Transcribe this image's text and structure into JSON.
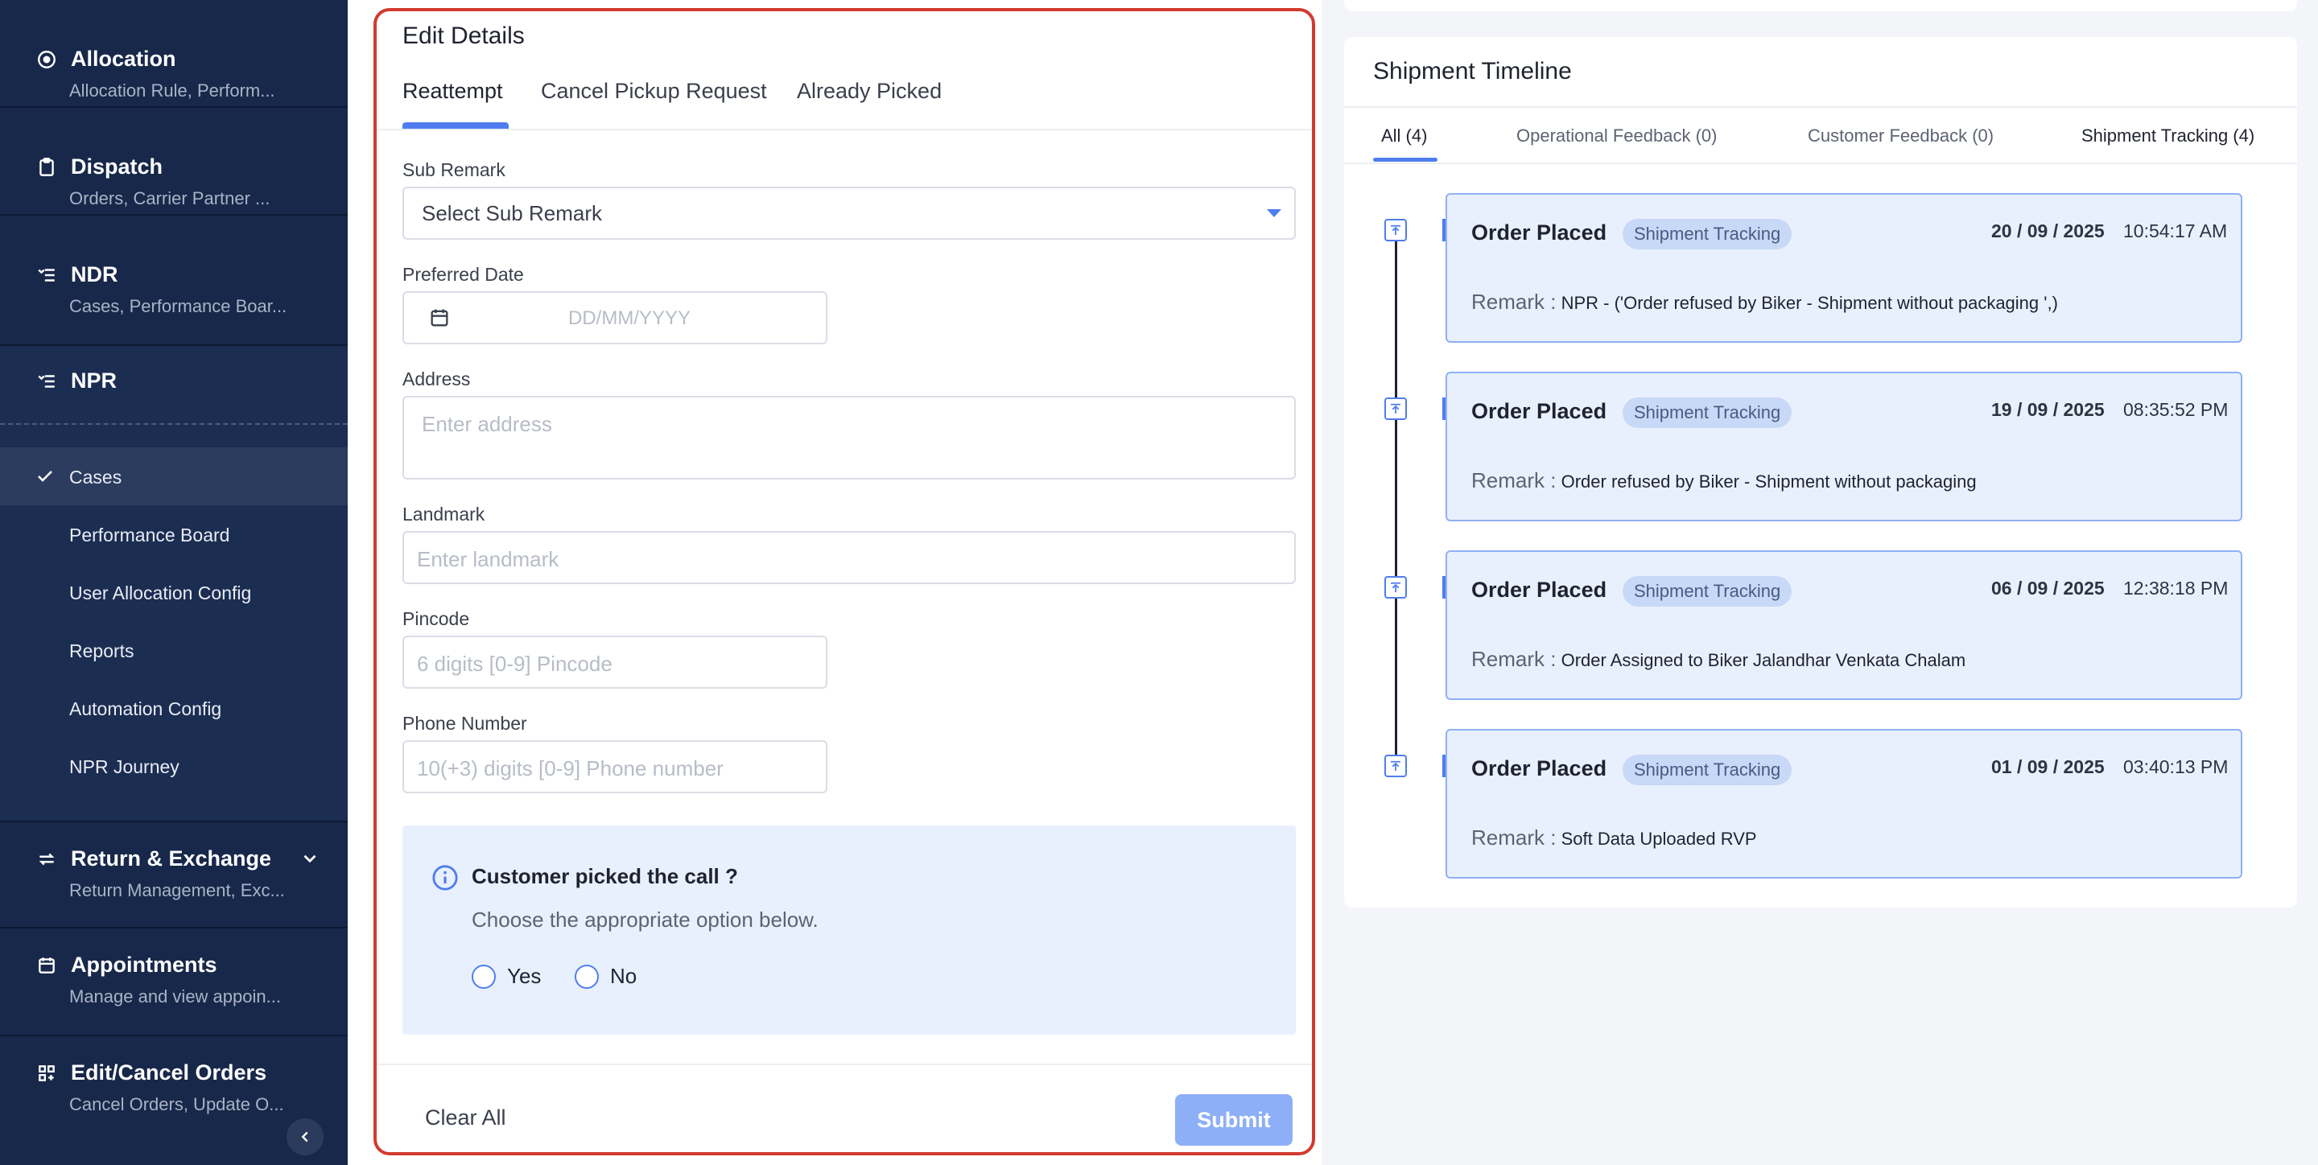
{
  "sidebar": {
    "groups": [
      {
        "title": "Allocation",
        "subtitle": "Allocation Rule, Perform...",
        "icon": "target-icon"
      },
      {
        "title": "Dispatch",
        "subtitle": "Orders, Carrier Partner ...",
        "icon": "clipboard-icon"
      },
      {
        "title": "NDR",
        "subtitle": "Cases, Performance Boar...",
        "icon": "list-icon"
      },
      {
        "title": "NPR",
        "icon": "list-icon"
      },
      {
        "title": "Return & Exchange",
        "subtitle": "Return Management, Exc...",
        "icon": "exchange-icon"
      },
      {
        "title": "Appointments",
        "subtitle": "Manage and view appoin...",
        "icon": "calendar-icon"
      },
      {
        "title": "Edit/Cancel Orders",
        "subtitle": "Cancel Orders, Update O...",
        "icon": "grid-icon"
      }
    ],
    "npr_items": [
      "Cases",
      "Performance Board",
      "User Allocation Config",
      "Reports",
      "Automation Config",
      "NPR Journey"
    ]
  },
  "edit": {
    "title": "Edit Details",
    "tabs": [
      "Reattempt",
      "Cancel Pickup Request",
      "Already Picked"
    ],
    "sub_remark_label": "Sub Remark",
    "sub_remark_value": "Select Sub Remark",
    "preferred_date_label": "Preferred Date",
    "preferred_date_placeholder": "DD/MM/YYYY",
    "address_label": "Address",
    "address_placeholder": "Enter address",
    "landmark_label": "Landmark",
    "landmark_placeholder": "Enter landmark",
    "pincode_label": "Pincode",
    "pincode_placeholder": "6 digits [0-9] Pincode",
    "phone_label": "Phone Number",
    "phone_placeholder": "10(+3) digits [0-9] Phone number",
    "info_title": "Customer picked the call ?",
    "info_text": "Choose the appropriate option below.",
    "options": [
      "Yes",
      "No"
    ],
    "clear_label": "Clear All",
    "submit_label": "Submit"
  },
  "timeline": {
    "title": "Shipment Timeline",
    "tabs": [
      "All (4)",
      "Operational Feedback (0)",
      "Customer Feedback (0)",
      "Shipment Tracking (4)"
    ],
    "remark_label": "Remark :",
    "events": [
      {
        "title": "Order Placed",
        "badge": "Shipment Tracking",
        "date": "20 / 09 / 2025",
        "time": "10:54:17 AM",
        "remark": "NPR - ('Order refused by Biker - Shipment without packaging ',)"
      },
      {
        "title": "Order Placed",
        "badge": "Shipment Tracking",
        "date": "19 / 09 / 2025",
        "time": "08:35:52 PM",
        "remark": "Order refused by Biker - Shipment without packaging"
      },
      {
        "title": "Order Placed",
        "badge": "Shipment Tracking",
        "date": "06 / 09 / 2025",
        "time": "12:38:18 PM",
        "remark": "Order Assigned to Biker Jalandhar Venkata Chalam"
      },
      {
        "title": "Order Placed",
        "badge": "Shipment Tracking",
        "date": "01 / 09 / 2025",
        "time": "03:40:13 PM",
        "remark": "Soft Data Uploaded RVP"
      }
    ]
  },
  "colors": {
    "sidebar": "#18284a",
    "accent": "#4f7df0",
    "highlight_border": "#d23a2e",
    "event_bg": "#e9f0fd"
  }
}
